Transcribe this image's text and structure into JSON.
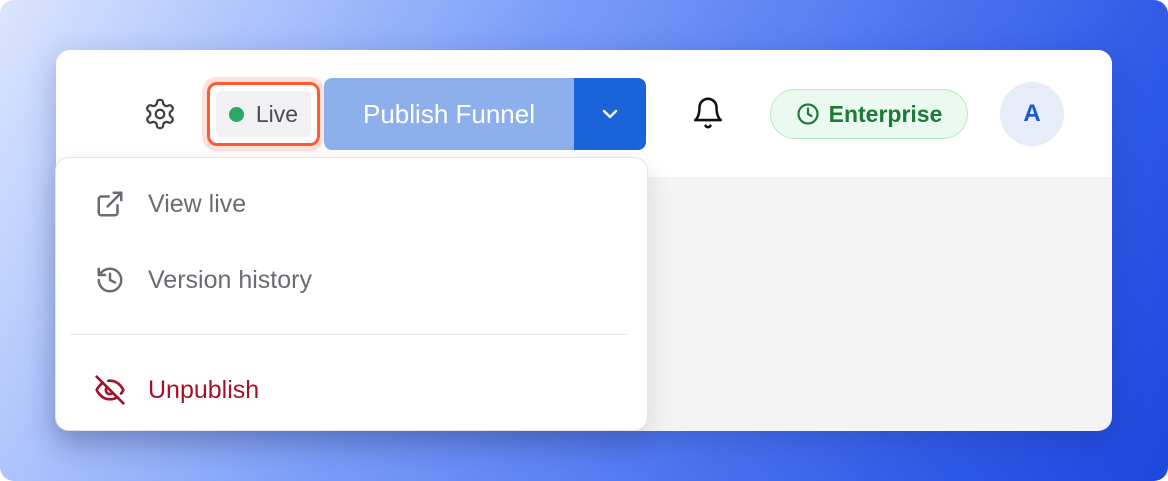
{
  "toolbar": {
    "settings_icon": "gear-icon",
    "status": {
      "label": "Live",
      "dot_color": "#2aa764",
      "highlight_color": "#ff5a36"
    },
    "publish": {
      "label": "Publish Funnel",
      "caret_icon": "chevron-down-icon",
      "color": "#8db0ec",
      "caret_color": "#1b63d9"
    },
    "notifications_icon": "bell-icon",
    "plan_badge": {
      "label": "Enterprise",
      "icon": "clock-icon",
      "color": "#1d7a37"
    },
    "avatar": {
      "initial": "A"
    }
  },
  "dropdown": {
    "items": [
      {
        "label": "View live",
        "icon": "external-link-icon"
      },
      {
        "label": "Version history",
        "icon": "history-icon"
      }
    ],
    "danger_item": {
      "label": "Unpublish",
      "icon": "eye-off-icon",
      "color": "#a4122a"
    }
  }
}
